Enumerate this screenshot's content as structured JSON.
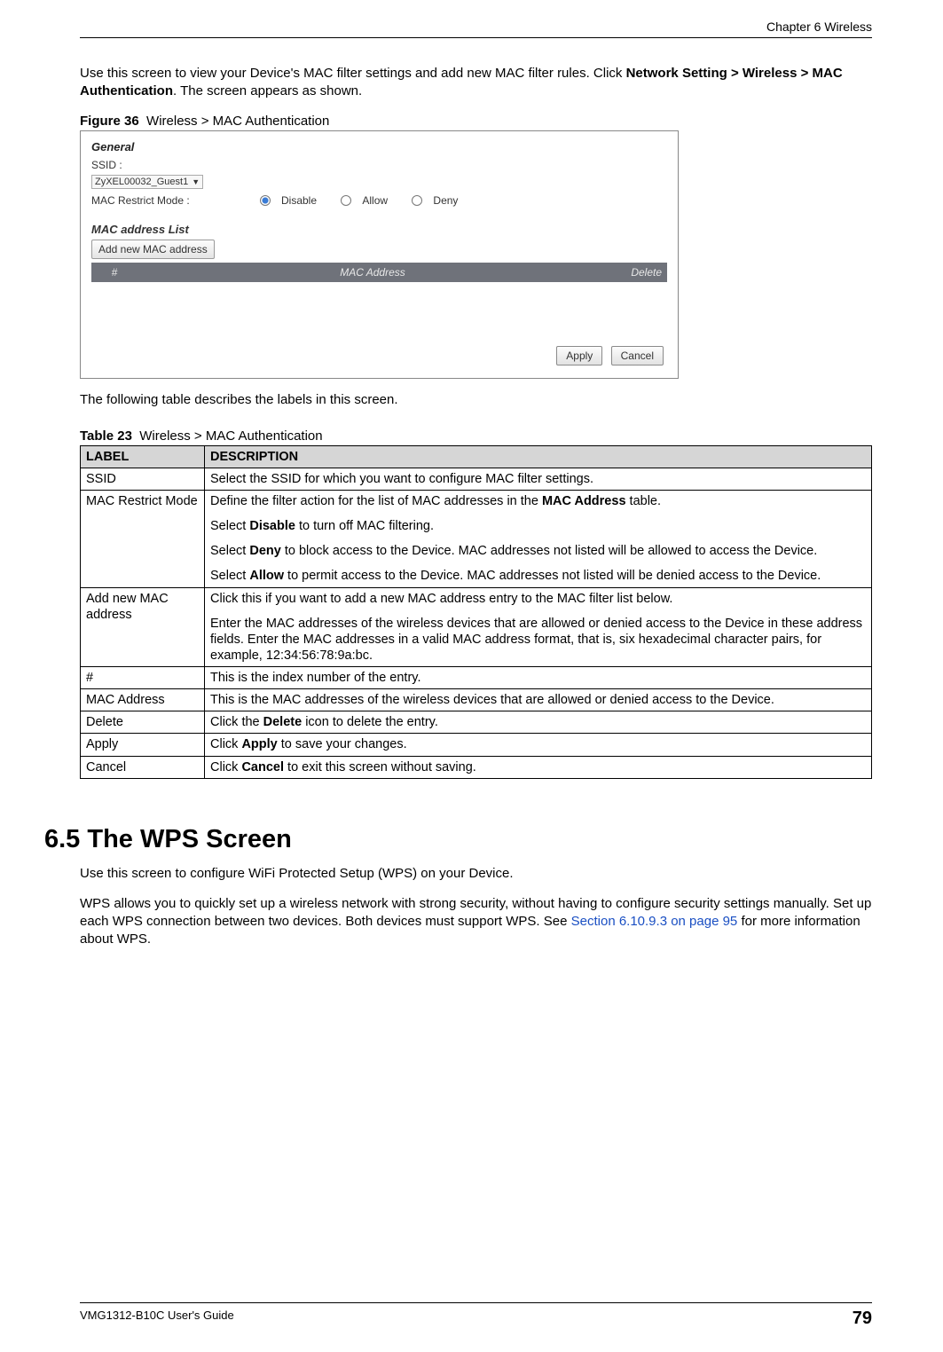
{
  "header": {
    "chapter": "Chapter 6 Wireless"
  },
  "intro": {
    "line1_pre": "Use this screen to view your Device's MAC filter settings and add new MAC filter rules. Click ",
    "nav_path": "Network Setting > Wireless > MAC Authentication",
    "line1_post": ". The screen appears as shown."
  },
  "figure": {
    "label": "Figure 36",
    "title": "Wireless > MAC Authentication"
  },
  "screenshot": {
    "general": "General",
    "ssid_label": "SSID :",
    "ssid_value": "ZyXEL00032_Guest1",
    "restrict_label": "MAC Restrict Mode :",
    "radio_disable": "Disable",
    "radio_allow": "Allow",
    "radio_deny": "Deny",
    "mac_list_head": "MAC address List",
    "add_btn": "Add new MAC address",
    "col_num": "#",
    "col_mac": "MAC Address",
    "col_del": "Delete",
    "apply_btn": "Apply",
    "cancel_btn": "Cancel"
  },
  "post_figure": "The following table describes the labels in this screen.",
  "table": {
    "label": "Table 23",
    "title": "Wireless > MAC Authentication",
    "head_label": "LABEL",
    "head_desc": "DESCRIPTION",
    "rows": [
      {
        "label": "SSID",
        "desc_parts": [
          {
            "t": "Select the SSID for which you want to configure MAC filter settings."
          }
        ]
      },
      {
        "label": "MAC Restrict Mode",
        "desc_parts": [
          {
            "t": "Define the filter action for the list of MAC addresses in the "
          },
          {
            "b": "MAC Address"
          },
          {
            "t": " table."
          },
          {
            "br": 1
          },
          {
            "t": "Select "
          },
          {
            "b": "Disable"
          },
          {
            "t": " to turn off MAC filtering."
          },
          {
            "br": 1
          },
          {
            "t": "Select "
          },
          {
            "b": "Deny"
          },
          {
            "t": " to block access to the Device. MAC addresses not listed will be allowed to access the Device."
          },
          {
            "br": 1
          },
          {
            "t": "Select "
          },
          {
            "b": "Allow"
          },
          {
            "t": " to permit access to the Device. MAC addresses not listed will be denied access to the Device."
          }
        ]
      },
      {
        "label": "Add new MAC address",
        "desc_parts": [
          {
            "t": "Click this if you want to add a new MAC address entry to the MAC filter list below."
          },
          {
            "br": 1
          },
          {
            "t": "Enter the MAC addresses of the wireless devices that are allowed or denied access to the Device in these address fields. Enter the MAC addresses in a valid MAC address format, that is, six hexadecimal character pairs, for example, 12:34:56:78:9a:bc."
          }
        ]
      },
      {
        "label": "#",
        "desc_parts": [
          {
            "t": "This is the index number of the entry."
          }
        ]
      },
      {
        "label": "MAC Address",
        "desc_parts": [
          {
            "t": "This is the MAC addresses of the wireless devices that are allowed or denied access to the Device."
          }
        ]
      },
      {
        "label": "Delete",
        "desc_parts": [
          {
            "t": "Click the "
          },
          {
            "b": "Delete"
          },
          {
            "t": " icon to delete the entry."
          }
        ]
      },
      {
        "label": "Apply",
        "desc_parts": [
          {
            "t": "Click "
          },
          {
            "b": "Apply"
          },
          {
            "t": " to save your changes."
          }
        ]
      },
      {
        "label": "Cancel",
        "desc_parts": [
          {
            "t": "Click "
          },
          {
            "b": "Cancel"
          },
          {
            "t": " to exit this screen without saving."
          }
        ]
      }
    ]
  },
  "section": {
    "heading": "6.5  The WPS Screen",
    "p1": "Use this screen to configure WiFi Protected Setup (WPS) on your Device.",
    "p2_pre": "WPS allows you to quickly set up a wireless network with strong security, without having to configure security settings manually. Set up each WPS connection between two devices. Both devices must support WPS. See ",
    "p2_link": "Section 6.10.9.3 on page 95",
    "p2_post": " for more information about WPS."
  },
  "footer": {
    "guide": "VMG1312-B10C User's Guide",
    "page": "79"
  }
}
